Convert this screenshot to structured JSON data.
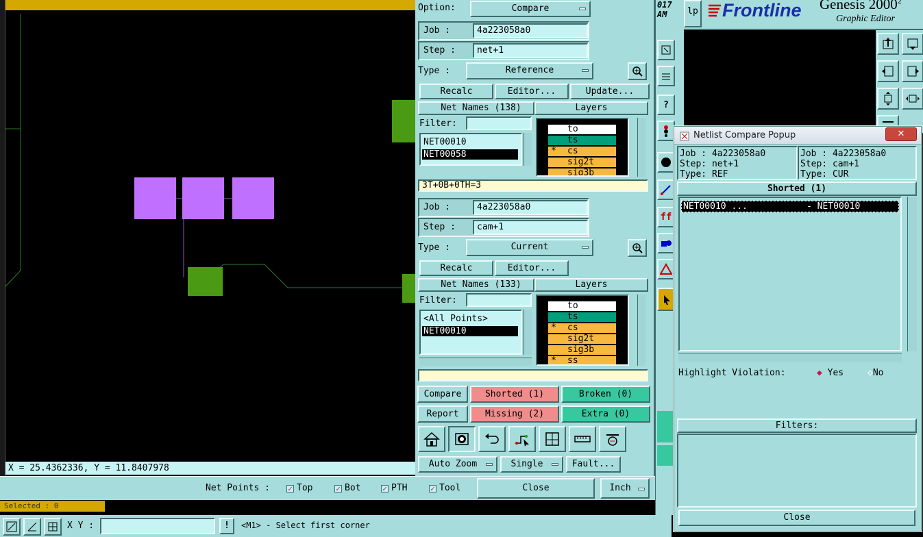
{
  "canvas": {
    "coord_readout": "X = 25.4362336, Y = 11.8407978",
    "selected_label": "Selected : 0",
    "colors": {
      "background": "#000000",
      "pad_purple": "#c070ff",
      "pad_green": "#4a9a14",
      "trace": "#2d7a2d",
      "top_bar": "#d4a800"
    }
  },
  "bottom_bar": {
    "xy_label": "X Y :",
    "xy_value": "",
    "exclaim": "!",
    "status_message": "<M1> - Select first corner"
  },
  "compare_panel": {
    "option_label": "Option:",
    "option_value": "Compare",
    "ref": {
      "job_label": "Job  :",
      "job_value": "4a223058a0",
      "step_label": "Step :",
      "step_value": "net+1",
      "type_label": "Type :",
      "type_value": "Reference",
      "recalc": "Recalc",
      "editor": "Editor...",
      "update": "Update...",
      "net_names_header": "Net Names (138)",
      "layers_header": "Layers",
      "filter_label": "Filter:",
      "filter_value": "",
      "nets": [
        "NET00010",
        "NET00058"
      ],
      "layers": [
        {
          "mark": "",
          "name": "to"
        },
        {
          "mark": "",
          "name": "ts"
        },
        {
          "mark": "*",
          "name": "cs"
        },
        {
          "mark": "",
          "name": "sig2t"
        },
        {
          "mark": "",
          "name": "sig3b"
        }
      ],
      "summary": "3T+0B+0TH=3"
    },
    "cur": {
      "job_label": "Job  :",
      "job_value": "4a223058a0",
      "step_label": "Step :",
      "step_value": "cam+1",
      "type_label": "Type :",
      "type_value": "Current",
      "recalc": "Recalc",
      "editor": "Editor...",
      "net_names_header": "Net Names (133)",
      "layers_header": "Layers",
      "filter_label": "Filter:",
      "filter_value": "",
      "nets": [
        "<All Points>",
        "NET00010"
      ],
      "layers": [
        {
          "mark": "",
          "name": "to"
        },
        {
          "mark": "",
          "name": "ts"
        },
        {
          "mark": "*",
          "name": "cs"
        },
        {
          "mark": "",
          "name": "sig2t"
        },
        {
          "mark": "",
          "name": "sig3b"
        },
        {
          "mark": "*",
          "name": "ss"
        }
      ],
      "summary": ""
    },
    "compare_btn": "Compare",
    "report_btn": "Report",
    "shorted_btn": "Shorted (1)",
    "missing_btn": "Missing (2)",
    "broken_btn": "Broken  (0)",
    "extra_btn": "Extra  (0)",
    "auto_zoom": "Auto Zoom",
    "single": "Single",
    "fault": "Fault...",
    "net_points_label": "Net Points :",
    "np_top": "Top",
    "np_bot": "Bot",
    "np_pth": "PTH",
    "np_tool": "Tool",
    "close": "Close",
    "units": "Inch",
    "colors": {
      "panel": "#a6dcdc",
      "layer_white": "#ffffff",
      "layer_green": "#009e7a",
      "layer_orange": "#f8b840",
      "alert_pink": "#f08c8c",
      "ok_green": "#38c8a0"
    }
  },
  "genesis_header": {
    "clip_top": "017",
    "clip_bottom": "AM",
    "help": "lp",
    "brand": "Frontline",
    "product": "Genesis 2000",
    "product_sup": "2",
    "subtitle": "Graphic Editor"
  },
  "popup": {
    "title": "Netlist Compare Popup",
    "left_job": "Job : 4a223058a0",
    "left_step": "Step: net+1",
    "left_type": "Type: REF",
    "right_job": "Job : 4a223058a0",
    "right_step": "Step: cam+1",
    "right_type": "Type: CUR",
    "section": "Shorted (1)",
    "row_left": "NET00010 ...",
    "row_right": "- NET00010",
    "highlight_label": "Highlight Violation:",
    "yes": "Yes",
    "no": "No",
    "filters": "Filters:",
    "close": "Close"
  }
}
